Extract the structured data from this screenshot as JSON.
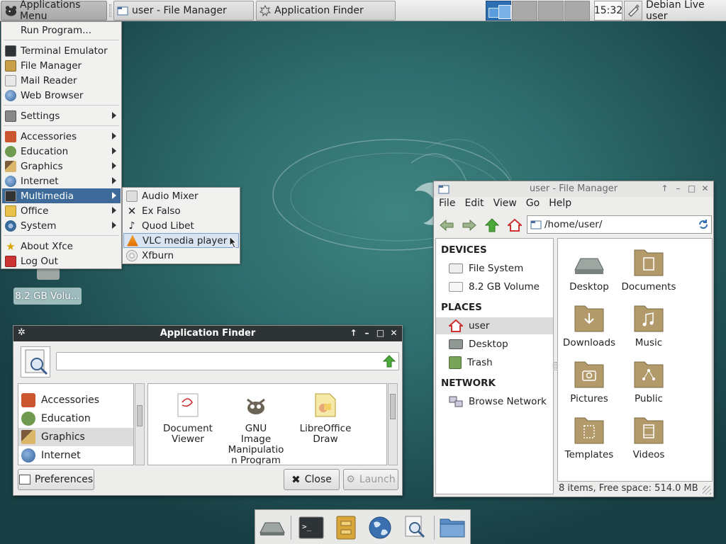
{
  "panel": {
    "app_menu_label": "Applications Menu",
    "tasks": [
      {
        "label": "user - File Manager",
        "icon": "file-manager-icon"
      },
      {
        "label": "Application Finder",
        "icon": "app-finder-icon"
      }
    ],
    "workspaces": 4,
    "active_workspace": 1,
    "clock": "15:32",
    "user": "Debian Live user"
  },
  "app_menu": {
    "items": [
      {
        "label": "Run Program..."
      },
      {
        "label": "Terminal Emulator"
      },
      {
        "label": "File Manager"
      },
      {
        "label": "Mail Reader"
      },
      {
        "label": "Web Browser"
      },
      {
        "label": "Settings"
      },
      {
        "label": "Accessories"
      },
      {
        "label": "Education"
      },
      {
        "label": "Graphics"
      },
      {
        "label": "Internet"
      },
      {
        "label": "Multimedia"
      },
      {
        "label": "Office"
      },
      {
        "label": "System"
      },
      {
        "label": "About Xfce"
      },
      {
        "label": "Log Out"
      }
    ],
    "highlighted": "Multimedia"
  },
  "multimedia_menu": {
    "items": [
      {
        "label": "Audio Mixer"
      },
      {
        "label": "Ex Falso"
      },
      {
        "label": "Quod Libet"
      },
      {
        "label": "VLC media player"
      },
      {
        "label": "Xfburn"
      }
    ],
    "hovered": "VLC media player"
  },
  "file_manager": {
    "title": "user - File Manager",
    "menubar": [
      "File",
      "Edit",
      "View",
      "Go",
      "Help"
    ],
    "path": "/home/user/",
    "sidebar": {
      "devices_header": "DEVICES",
      "devices": [
        "File System",
        "8.2 GB Volume"
      ],
      "places_header": "PLACES",
      "places": [
        "user",
        "Desktop",
        "Trash"
      ],
      "network_header": "NETWORK",
      "network": [
        "Browse Network"
      ],
      "selected": "user"
    },
    "items": [
      "Desktop",
      "Documents",
      "Downloads",
      "Music",
      "Pictures",
      "Public",
      "Templates",
      "Videos"
    ],
    "status": "8 items, Free space: 514.0 MB"
  },
  "app_finder": {
    "title": "Application Finder",
    "search_value": "",
    "categories": [
      "Accessories",
      "Education",
      "Graphics",
      "Internet"
    ],
    "selected_category": "Graphics",
    "apps": [
      {
        "name": "Document Viewer"
      },
      {
        "name": "GNU Image Manipulation Program",
        "display": [
          "GNU",
          "Image",
          "Manipulatio",
          "n Program"
        ]
      },
      {
        "name": "LibreOffice Draw"
      }
    ],
    "preferences_label": "Preferences",
    "close_label": "Close",
    "launch_label": "Launch"
  },
  "desktop": {
    "volume_label": "8.2 GB Volu..."
  },
  "colors": {
    "menu_highlight": "#3d6a99",
    "workspace_active": "#2d6fb3",
    "folder": "#b39a6b",
    "desktop_teal": "#2f6e6e"
  }
}
